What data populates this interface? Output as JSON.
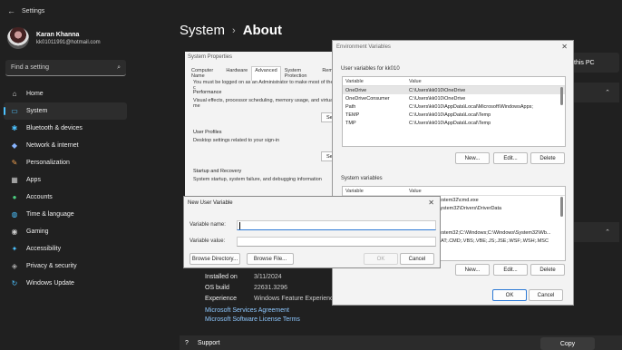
{
  "app": {
    "title": "Settings"
  },
  "profile": {
    "name": "Karan Khanna",
    "email": "kk01011991@hotmail.com"
  },
  "search": {
    "placeholder": "Find a setting"
  },
  "nav": [
    {
      "label": "Home",
      "icon": "home-icon",
      "glyph": "⌂",
      "color": "#dddddd"
    },
    {
      "label": "System",
      "icon": "monitor-icon",
      "glyph": "▭",
      "color": "#4cc2ff",
      "active": true
    },
    {
      "label": "Bluetooth & devices",
      "icon": "bluetooth-icon",
      "glyph": "✱",
      "color": "#4cc2ff"
    },
    {
      "label": "Network & internet",
      "icon": "wifi-icon",
      "glyph": "◆",
      "color": "#88b4ff"
    },
    {
      "label": "Personalization",
      "icon": "paintbrush-icon",
      "glyph": "✎",
      "color": "#f0a050"
    },
    {
      "label": "Apps",
      "icon": "apps-icon",
      "glyph": "▦",
      "color": "#cccccc"
    },
    {
      "label": "Accounts",
      "icon": "person-icon",
      "glyph": "●",
      "color": "#4ccf80"
    },
    {
      "label": "Time & language",
      "icon": "globe-icon",
      "glyph": "◍",
      "color": "#4cc2ff"
    },
    {
      "label": "Gaming",
      "icon": "gamepad-icon",
      "glyph": "◉",
      "color": "#cccccc"
    },
    {
      "label": "Accessibility",
      "icon": "accessibility-icon",
      "glyph": "✦",
      "color": "#4cc2ff"
    },
    {
      "label": "Privacy & security",
      "icon": "shield-icon",
      "glyph": "◈",
      "color": "#aaaaaa"
    },
    {
      "label": "Windows Update",
      "icon": "update-icon",
      "glyph": "↻",
      "color": "#4cc2ff"
    }
  ],
  "breadcrumb": {
    "parent": "System",
    "current": "About"
  },
  "rename_button": "this PC",
  "specs": {
    "installed_on_label": "Installed on",
    "installed_on_value": "3/11/2024",
    "os_build_label": "OS build",
    "os_build_value": "22631.3296",
    "experience_label": "Experience",
    "experience_value": "Windows Feature Experience",
    "link_services": "Microsoft Services Agreement",
    "link_license": "Microsoft Software License Terms"
  },
  "support": {
    "label": "Support",
    "copy": "Copy"
  },
  "sysprops": {
    "title": "System Properties",
    "tabs": [
      "Computer Name",
      "Hardware",
      "Advanced",
      "System Protection",
      "Remo"
    ],
    "admin_note": "You must be logged on as an Administrator to make most of these c",
    "performance_title": "Performance",
    "performance_desc": "Visual effects, processor scheduling, memory usage, and virtual me",
    "profiles_title": "User Profiles",
    "profiles_desc": "Desktop settings related to your sign-in",
    "startup_title": "Startup and Recovery",
    "startup_desc": "System startup, system failure, and debugging information",
    "settings_btn": "Se"
  },
  "envvars": {
    "title": "Environment Variables",
    "user_label": "User variables for kk010",
    "col_variable": "Variable",
    "col_value": "Value",
    "user_rows": [
      {
        "variable": "OneDrive",
        "value": "C:\\Users\\kk010\\OneDrive"
      },
      {
        "variable": "OneDriveConsumer",
        "value": "C:\\Users\\kk010\\OneDrive"
      },
      {
        "variable": "Path",
        "value": "C:\\Users\\kk010\\AppData\\Local\\Microsoft\\WindowsApps;"
      },
      {
        "variable": "TEMP",
        "value": "C:\\Users\\kk010\\AppData\\Local\\Temp"
      },
      {
        "variable": "TMP",
        "value": "C:\\Users\\kk010\\AppData\\Local\\Temp"
      }
    ],
    "system_label": "System variables",
    "system_rows": [
      {
        "variable": "",
        "value": "C:\\Windows\\system32\\cmd.exe"
      },
      {
        "variable": "",
        "value": "C:\\Windows\\System32\\Drivers\\DriverData"
      },
      {
        "variable": "",
        "value": ""
      },
      {
        "variable": "",
        "value": ""
      },
      {
        "variable": "",
        "value": "C:\\Windows\\system32;C:\\Windows;C:\\Windows\\System32\\Wb..."
      },
      {
        "variable": "",
        "value": ".COM;.EXE;.BAT;.CMD;.VBS;.VBE;.JS;.JSE;.WSF;.WSH;.MSC"
      }
    ],
    "btn_new": "New...",
    "btn_edit": "Edit...",
    "btn_delete": "Delete",
    "btn_ok": "OK",
    "btn_cancel": "Cancel"
  },
  "newvar": {
    "title": "New User Variable",
    "name_label": "Variable name:",
    "value_label": "Variable value:",
    "name_value": "",
    "value_value": "",
    "browse_dir": "Browse Directory...",
    "browse_file": "Browse File...",
    "ok": "OK",
    "cancel": "Cancel"
  },
  "colors": {
    "accent": "#4cc2ff",
    "link": "#8ec8ff",
    "bg": "#202020"
  }
}
